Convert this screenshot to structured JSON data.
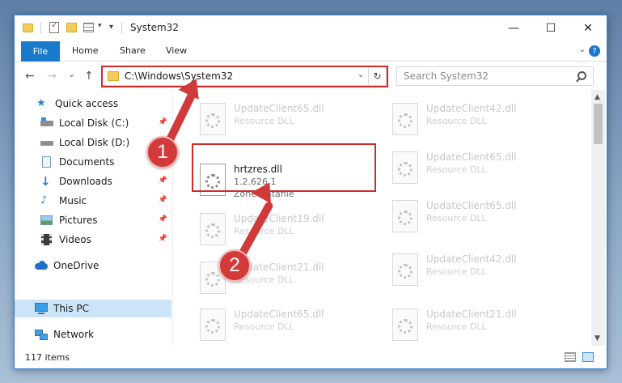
{
  "window": {
    "title": "System32",
    "controls": {
      "minimize": "—",
      "maximize": "☐",
      "close": "✕"
    }
  },
  "ribbon": {
    "file_tab": "File",
    "tabs": [
      "Home",
      "Share",
      "View"
    ],
    "help": "?"
  },
  "navigation": {
    "back": "←",
    "forward": "→",
    "recent": "⌄",
    "up": "↑",
    "address": "C:\\Windows\\System32",
    "refresh": "↻",
    "search_placeholder": "Search System32"
  },
  "sidebar": {
    "items": [
      {
        "label": "Quick access",
        "icon": "star-icon",
        "pinned": false
      },
      {
        "label": "Local Disk (C:)",
        "icon": "drive-icon",
        "pinned": true
      },
      {
        "label": "Local Disk (D:)",
        "icon": "drive-icon",
        "pinned": false
      },
      {
        "label": "Documents",
        "icon": "documents-icon",
        "pinned": true
      },
      {
        "label": "Downloads",
        "icon": "download-icon",
        "pinned": true
      },
      {
        "label": "Music",
        "icon": "music-icon",
        "pinned": true
      },
      {
        "label": "Pictures",
        "icon": "pictures-icon",
        "pinned": true
      },
      {
        "label": "Videos",
        "icon": "videos-icon",
        "pinned": true
      },
      {
        "label": "OneDrive",
        "icon": "onedrive-icon",
        "pinned": false
      },
      {
        "label": "This PC",
        "icon": "computer-icon",
        "pinned": false,
        "selected": true
      },
      {
        "label": "Network",
        "icon": "network-icon",
        "pinned": false
      }
    ]
  },
  "files": {
    "left": [
      {
        "name": "UpdateClient65.dll",
        "type": "Resource DLL"
      },
      {
        "name": "hrtzres.dll",
        "version": "1.2.626.1",
        "type": "Zone Datafile",
        "highlighted": true
      },
      {
        "name": "UpdateClient19.dll",
        "type": "Resource DLL"
      },
      {
        "name": "UpdateClient21.dll",
        "type": "Resource DLL"
      },
      {
        "name": "UpdateClient65.dll",
        "type": "Resource DLL"
      }
    ],
    "right": [
      {
        "name": "UpdateClient42.dll",
        "type": "Resource DLL"
      },
      {
        "name": "UpdateClient65.dll",
        "type": "Resource DLL"
      },
      {
        "name": "UpdateClient65.dll",
        "type": "Resource DLL"
      },
      {
        "name": "UpdateClient42.dll",
        "type": "Resource DLL"
      },
      {
        "name": "UpdateClient21.dll",
        "type": "Resource DLL"
      }
    ]
  },
  "status": {
    "item_count": "117 items"
  },
  "callouts": {
    "step1": "1",
    "step2": "2",
    "color": "#d13a3a"
  }
}
